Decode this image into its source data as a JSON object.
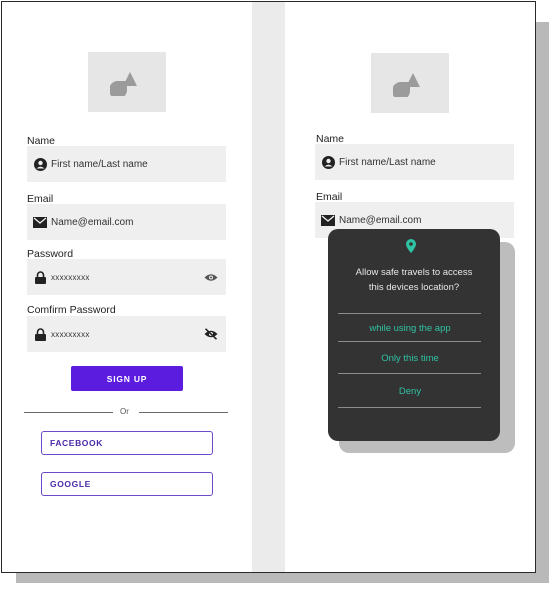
{
  "left_screen": {
    "name_label": "Name",
    "name_placeholder": "First name/Last name",
    "email_label": "Email",
    "email_placeholder": "Name@email.com",
    "password_label": "Password",
    "password_value": "xxxxxxxxx",
    "confirm_label": "Comfirm Password",
    "confirm_value": "xxxxxxxxx",
    "signup_label": "SIGN UP",
    "or_text": "Or",
    "facebook_label": "FACEBOOK",
    "google_label": "GOOGLE"
  },
  "right_screen": {
    "name_label": "Name",
    "name_placeholder": "First name/Last name",
    "email_label": "Email",
    "email_placeholder": "Name@email.com"
  },
  "location_dialog": {
    "message_line1": "Allow safe travels to access",
    "message_line2": "this devices location?",
    "options": [
      "while using the app",
      "Only this time",
      "Deny"
    ]
  },
  "colors": {
    "primary": "#5b1ce0",
    "dialog_bg": "#333333",
    "dialog_accent": "#2fc3a4",
    "field_bg": "#efefef"
  },
  "icons": [
    "logo-shapes-icon",
    "account-circle-icon",
    "mail-icon",
    "lock-icon",
    "eye-icon",
    "eye-off-icon",
    "location-pin-icon"
  ]
}
